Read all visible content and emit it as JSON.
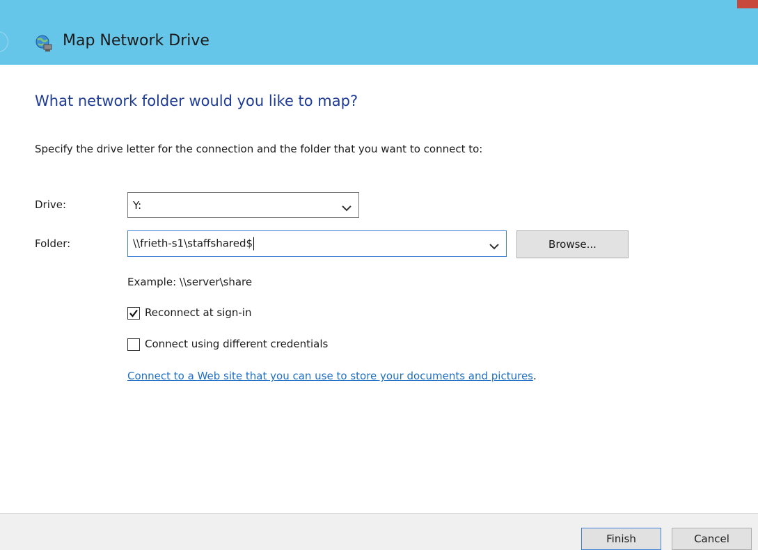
{
  "window": {
    "title": "Map Network Drive",
    "title_icon": "network-drive-globe-icon"
  },
  "page": {
    "heading": "What network folder would you like to map?",
    "instructions": "Specify the drive letter for the connection and the folder that you want to connect to:"
  },
  "drive": {
    "label": "Drive:",
    "value": "Y:"
  },
  "folder": {
    "label": "Folder:",
    "value": "\\\\frieth-s1\\staffshared$",
    "browse_label": "Browse...",
    "example": "Example: \\\\server\\share"
  },
  "options": {
    "reconnect_label": "Reconnect at sign-in",
    "reconnect_checked": true,
    "credentials_label": "Connect using different credentials",
    "credentials_checked": false
  },
  "link": {
    "text": "Connect to a Web site that you can use to store your documents and pictures",
    "trailing": "."
  },
  "footer": {
    "finish_label": "Finish",
    "cancel_label": "Cancel"
  },
  "colors": {
    "titlebar": "#66c6e9",
    "heading": "#1e3c96",
    "link": "#1f6fc5",
    "focus_border": "#3c7fd6"
  }
}
